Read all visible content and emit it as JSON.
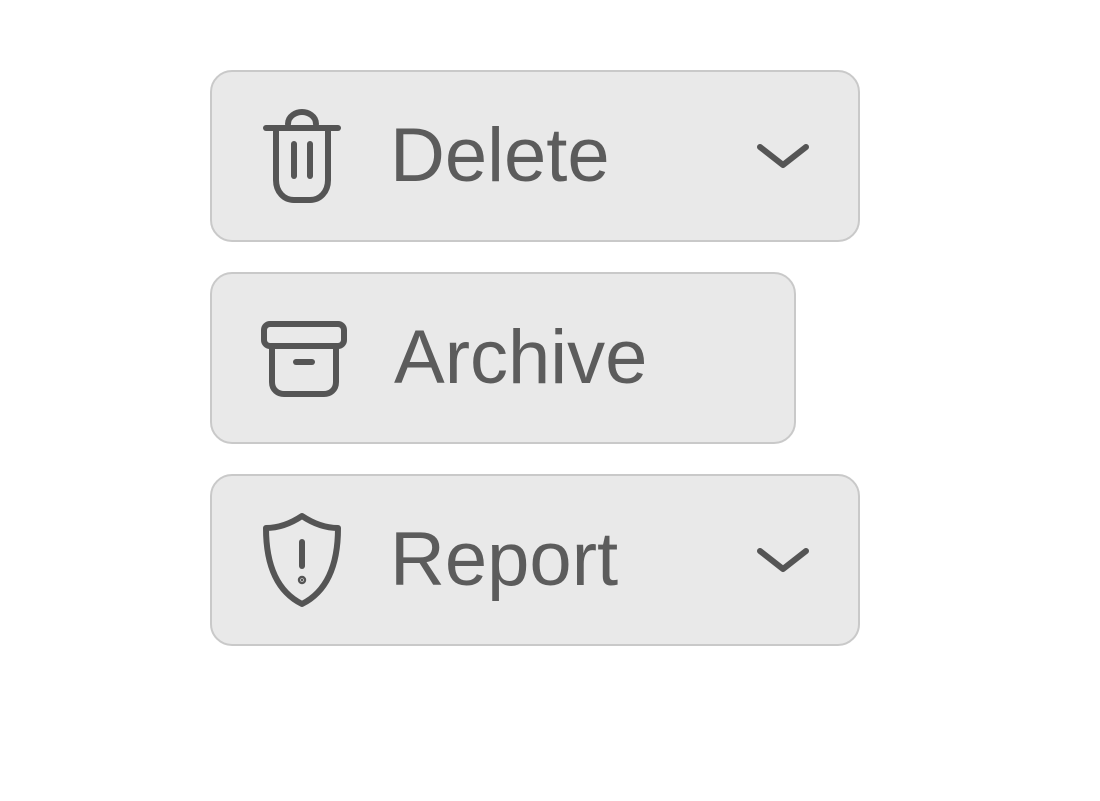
{
  "actions": {
    "delete": {
      "label": "Delete",
      "has_dropdown": true
    },
    "archive": {
      "label": "Archive",
      "has_dropdown": false
    },
    "report": {
      "label": "Report",
      "has_dropdown": true
    }
  },
  "colors": {
    "button_bg": "#e9e9e9",
    "button_border": "#c9c9c9",
    "icon_stroke": "#555555",
    "label_text": "#5c5c5c"
  }
}
